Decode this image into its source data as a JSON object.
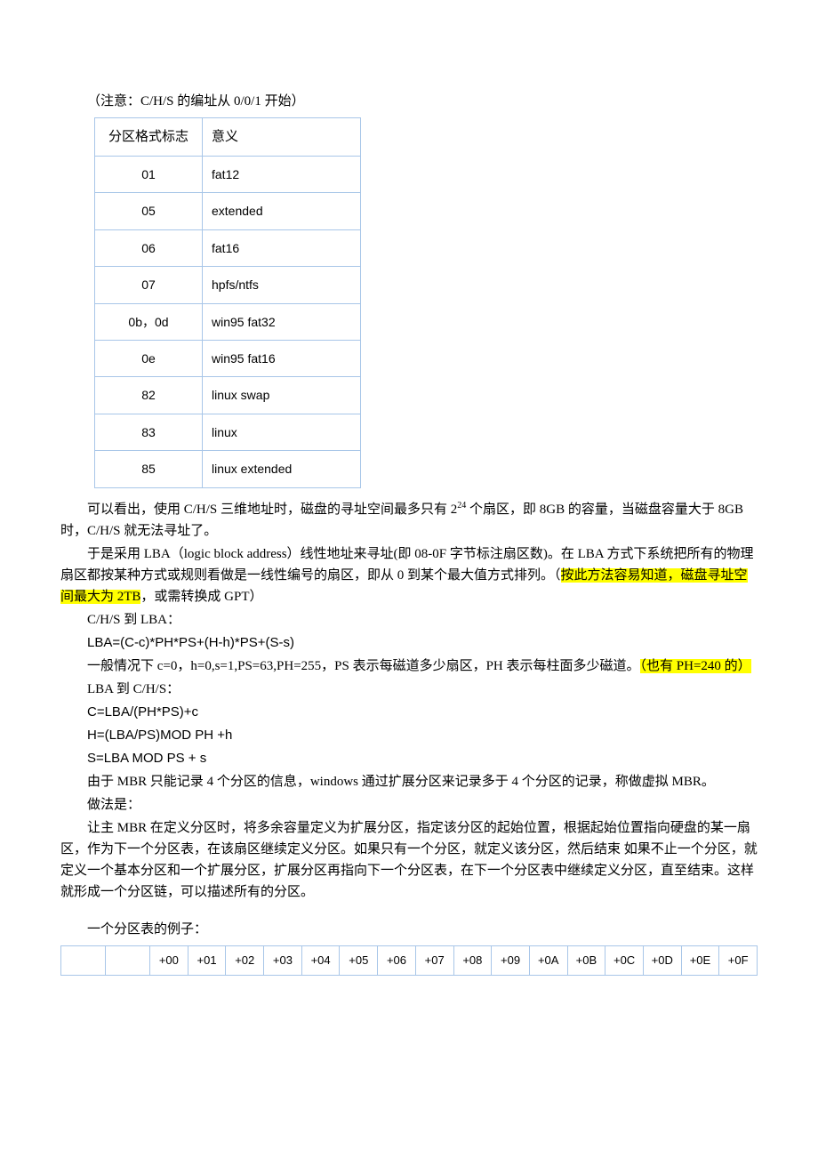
{
  "top_note": "（注意：C/H/S 的编址从 0/0/1 开始）",
  "table1": {
    "headers": [
      "分区格式标志",
      "意义"
    ],
    "rows": [
      [
        "01",
        "fat12"
      ],
      [
        "05",
        "extended"
      ],
      [
        "06",
        "fat16"
      ],
      [
        "07",
        "hpfs/ntfs"
      ],
      [
        "0b，0d",
        "win95 fat32"
      ],
      [
        "0e",
        "win95 fat16"
      ],
      [
        "82",
        "linux swap"
      ],
      [
        "83",
        "linux"
      ],
      [
        "85",
        "linux extended"
      ]
    ]
  },
  "p1a": "可以看出，使用 C/H/S 三维地址时，磁盘的寻址空间最多只有 2",
  "p1sup": "24",
  "p1b": " 个扇区，即 8GB 的容量，当磁盘容量大于 8GB 时，C/H/S 就无法寻址了。",
  "p2a": "于是采用 LBA（logic block address）线性地址来寻址(即 08-0F 字节标注扇区数)。在 LBA 方式下系统把所有的物理扇区都按某种方式或规则看做是一线性编号的扇区，即从 0 到某个最大值方式排列。（",
  "p2hl": "按此方法容易知道，磁盘寻址空间最大为 2TB",
  "p2b": "，或需转换成 GPT）",
  "p3": "C/H/S 到 LBA：",
  "p4": "LBA=(C-c)*PH*PS+(H-h)*PS+(S-s)",
  "p5a": "一般情况下 c=0，h=0,s=1,PS=63,PH=255，PS 表示每磁道多少扇区，PH 表示每柱面多少磁道。",
  "p5hl": "（也有 PH=240 的）",
  "p6": "LBA 到 C/H/S：",
  "p7": "C=LBA/(PH*PS)+c",
  "p8": "H=(LBA/PS)MOD PH +h",
  "p9": "S=LBA MOD PS + s",
  "p10": "由于 MBR 只能记录 4 个分区的信息，windows 通过扩展分区来记录多于 4 个分区的记录，称做虚拟 MBR。",
  "p11": "做法是：",
  "p12": "让主 MBR 在定义分区时，将多余容量定义为扩展分区，指定该分区的起始位置，根据起始位置指向硬盘的某一扇区，作为下一个分区表，在该扇区继续定义分区。如果只有一个分区，就定义该分区，然后结束  如果不止一个分区，就定义一个基本分区和一个扩展分区，扩展分区再指向下一个分区表，在下一个分区表中继续定义分区，直至结束。这样就形成一个分区链，可以描述所有的分区。",
  "p13": "一个分区表的例子：",
  "table2": {
    "headers": [
      "",
      "",
      "+00",
      "+01",
      "+02",
      "+03",
      "+04",
      "+05",
      "+06",
      "+07",
      "+08",
      "+09",
      "+0A",
      "+0B",
      "+0C",
      "+0D",
      "+0E",
      "+0F"
    ]
  }
}
